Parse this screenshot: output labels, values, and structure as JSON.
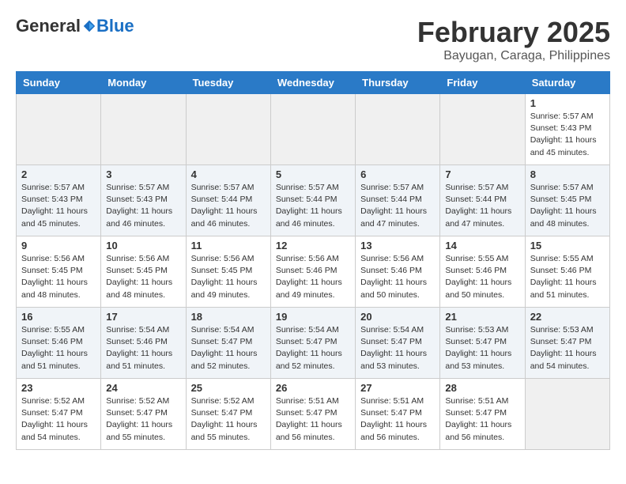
{
  "header": {
    "logo_general": "General",
    "logo_blue": "Blue",
    "month_title": "February 2025",
    "location": "Bayugan, Caraga, Philippines"
  },
  "calendar": {
    "days_of_week": [
      "Sunday",
      "Monday",
      "Tuesday",
      "Wednesday",
      "Thursday",
      "Friday",
      "Saturday"
    ],
    "weeks": [
      [
        {
          "day": "",
          "info": ""
        },
        {
          "day": "",
          "info": ""
        },
        {
          "day": "",
          "info": ""
        },
        {
          "day": "",
          "info": ""
        },
        {
          "day": "",
          "info": ""
        },
        {
          "day": "",
          "info": ""
        },
        {
          "day": "1",
          "info": "Sunrise: 5:57 AM\nSunset: 5:43 PM\nDaylight: 11 hours\nand 45 minutes."
        }
      ],
      [
        {
          "day": "2",
          "info": "Sunrise: 5:57 AM\nSunset: 5:43 PM\nDaylight: 11 hours\nand 45 minutes."
        },
        {
          "day": "3",
          "info": "Sunrise: 5:57 AM\nSunset: 5:43 PM\nDaylight: 11 hours\nand 46 minutes."
        },
        {
          "day": "4",
          "info": "Sunrise: 5:57 AM\nSunset: 5:44 PM\nDaylight: 11 hours\nand 46 minutes."
        },
        {
          "day": "5",
          "info": "Sunrise: 5:57 AM\nSunset: 5:44 PM\nDaylight: 11 hours\nand 46 minutes."
        },
        {
          "day": "6",
          "info": "Sunrise: 5:57 AM\nSunset: 5:44 PM\nDaylight: 11 hours\nand 47 minutes."
        },
        {
          "day": "7",
          "info": "Sunrise: 5:57 AM\nSunset: 5:44 PM\nDaylight: 11 hours\nand 47 minutes."
        },
        {
          "day": "8",
          "info": "Sunrise: 5:57 AM\nSunset: 5:45 PM\nDaylight: 11 hours\nand 48 minutes."
        }
      ],
      [
        {
          "day": "9",
          "info": "Sunrise: 5:56 AM\nSunset: 5:45 PM\nDaylight: 11 hours\nand 48 minutes."
        },
        {
          "day": "10",
          "info": "Sunrise: 5:56 AM\nSunset: 5:45 PM\nDaylight: 11 hours\nand 48 minutes."
        },
        {
          "day": "11",
          "info": "Sunrise: 5:56 AM\nSunset: 5:45 PM\nDaylight: 11 hours\nand 49 minutes."
        },
        {
          "day": "12",
          "info": "Sunrise: 5:56 AM\nSunset: 5:46 PM\nDaylight: 11 hours\nand 49 minutes."
        },
        {
          "day": "13",
          "info": "Sunrise: 5:56 AM\nSunset: 5:46 PM\nDaylight: 11 hours\nand 50 minutes."
        },
        {
          "day": "14",
          "info": "Sunrise: 5:55 AM\nSunset: 5:46 PM\nDaylight: 11 hours\nand 50 minutes."
        },
        {
          "day": "15",
          "info": "Sunrise: 5:55 AM\nSunset: 5:46 PM\nDaylight: 11 hours\nand 51 minutes."
        }
      ],
      [
        {
          "day": "16",
          "info": "Sunrise: 5:55 AM\nSunset: 5:46 PM\nDaylight: 11 hours\nand 51 minutes."
        },
        {
          "day": "17",
          "info": "Sunrise: 5:54 AM\nSunset: 5:46 PM\nDaylight: 11 hours\nand 51 minutes."
        },
        {
          "day": "18",
          "info": "Sunrise: 5:54 AM\nSunset: 5:47 PM\nDaylight: 11 hours\nand 52 minutes."
        },
        {
          "day": "19",
          "info": "Sunrise: 5:54 AM\nSunset: 5:47 PM\nDaylight: 11 hours\nand 52 minutes."
        },
        {
          "day": "20",
          "info": "Sunrise: 5:54 AM\nSunset: 5:47 PM\nDaylight: 11 hours\nand 53 minutes."
        },
        {
          "day": "21",
          "info": "Sunrise: 5:53 AM\nSunset: 5:47 PM\nDaylight: 11 hours\nand 53 minutes."
        },
        {
          "day": "22",
          "info": "Sunrise: 5:53 AM\nSunset: 5:47 PM\nDaylight: 11 hours\nand 54 minutes."
        }
      ],
      [
        {
          "day": "23",
          "info": "Sunrise: 5:52 AM\nSunset: 5:47 PM\nDaylight: 11 hours\nand 54 minutes."
        },
        {
          "day": "24",
          "info": "Sunrise: 5:52 AM\nSunset: 5:47 PM\nDaylight: 11 hours\nand 55 minutes."
        },
        {
          "day": "25",
          "info": "Sunrise: 5:52 AM\nSunset: 5:47 PM\nDaylight: 11 hours\nand 55 minutes."
        },
        {
          "day": "26",
          "info": "Sunrise: 5:51 AM\nSunset: 5:47 PM\nDaylight: 11 hours\nand 56 minutes."
        },
        {
          "day": "27",
          "info": "Sunrise: 5:51 AM\nSunset: 5:47 PM\nDaylight: 11 hours\nand 56 minutes."
        },
        {
          "day": "28",
          "info": "Sunrise: 5:51 AM\nSunset: 5:47 PM\nDaylight: 11 hours\nand 56 minutes."
        },
        {
          "day": "",
          "info": ""
        }
      ]
    ]
  }
}
